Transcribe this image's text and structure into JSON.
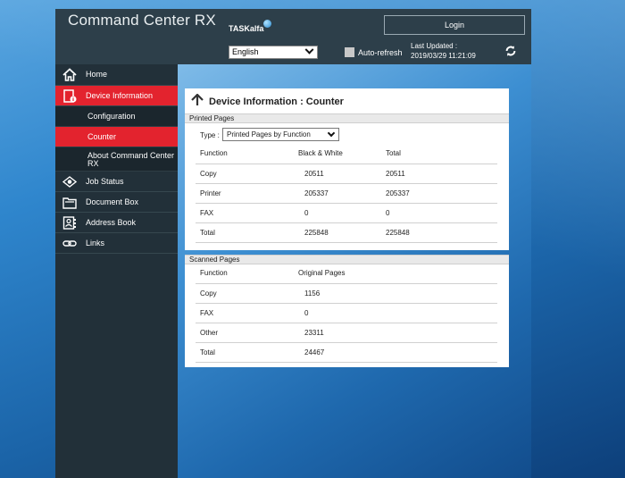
{
  "header": {
    "brand": "Command Center RX",
    "model": "TASKalfa",
    "login_label": "Login",
    "language": "English",
    "autorefresh_label": "Auto-refresh",
    "last_updated_label": "Last Updated :",
    "last_updated_value": "2019/03/29 11:21:09"
  },
  "sidebar": {
    "home": "Home",
    "device_information": "Device Information",
    "configuration": "Configuration",
    "counter": "Counter",
    "about": "About Command Center RX",
    "job_status": "Job Status",
    "document_box": "Document Box",
    "address_book": "Address Book",
    "links": "Links"
  },
  "main": {
    "title": "Device Information : Counter",
    "printed": {
      "section_label": "Printed Pages",
      "type_label": "Type :",
      "type_value": "Printed Pages by Function",
      "columns": [
        "Function",
        "Black & White",
        "Total"
      ],
      "rows": [
        [
          "Copy",
          "20511",
          "20511"
        ],
        [
          "Printer",
          "205337",
          "205337"
        ],
        [
          "FAX",
          "0",
          "0"
        ],
        [
          "Total",
          "225848",
          "225848"
        ]
      ]
    },
    "scanned": {
      "section_label": "Scanned Pages",
      "columns": [
        "Function",
        "Original Pages"
      ],
      "rows": [
        [
          "Copy",
          "1156"
        ],
        [
          "FAX",
          "0"
        ],
        [
          "Other",
          "23311"
        ],
        [
          "Total",
          "24467"
        ]
      ]
    }
  }
}
